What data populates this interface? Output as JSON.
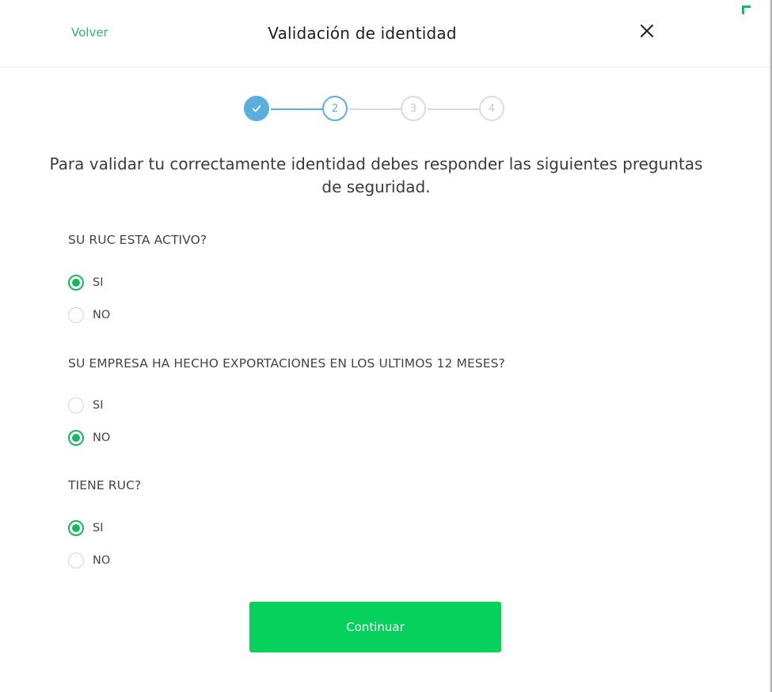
{
  "header": {
    "back_label": "Volver",
    "title": "Validación de identidad",
    "close_icon": "close-icon"
  },
  "stepper": {
    "steps": [
      {
        "label": "",
        "state": "done",
        "icon": "check-icon"
      },
      {
        "label": "2",
        "state": "current"
      },
      {
        "label": "3",
        "state": "todo"
      },
      {
        "label": "4",
        "state": "todo"
      }
    ],
    "active_color": "#5aaee0",
    "inactive_color": "#d9d9d9"
  },
  "intro_text": "Para validar tu correctamente identidad debes responder las siguientes preguntas de seguridad.",
  "questions": [
    {
      "text": "SU RUC ESTA ACTIVO?",
      "options": [
        {
          "label": "SI",
          "selected": true
        },
        {
          "label": "NO",
          "selected": false
        }
      ]
    },
    {
      "text": "SU EMPRESA HA HECHO EXPORTACIONES EN LOS ULTIMOS 12 MESES?",
      "options": [
        {
          "label": "SI",
          "selected": false
        },
        {
          "label": "NO",
          "selected": true
        }
      ]
    },
    {
      "text": "TIENE RUC?",
      "options": [
        {
          "label": "SI",
          "selected": true
        },
        {
          "label": "NO",
          "selected": false
        }
      ]
    }
  ],
  "continue_label": "Continuar",
  "colors": {
    "brand_green": "#06d15d",
    "radio_green": "#18b85a",
    "link_green": "#2bb673"
  }
}
